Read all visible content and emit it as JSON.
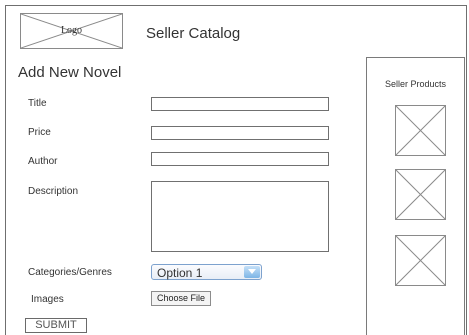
{
  "header": {
    "logo_text": "Logo",
    "app_title": "Seller Catalog"
  },
  "form": {
    "title": "Add New Novel",
    "title_label": "Title",
    "title_value": "",
    "price_label": "Price",
    "price_value": "",
    "author_label": "Author",
    "author_value": "",
    "description_label": "Description",
    "description_value": "",
    "categories_label": "Categories/Genres",
    "categories_selected": "Option 1",
    "images_label": "Images",
    "choose_file_label": "Choose File",
    "submit_label": "SUBMIT"
  },
  "seller_products": {
    "title": "Seller Products",
    "items": [
      {
        "icon": "image-placeholder-icon"
      },
      {
        "icon": "image-placeholder-icon"
      },
      {
        "icon": "image-placeholder-icon"
      }
    ]
  },
  "colors": {
    "border": "#707070",
    "select_accent": "#7db5e6"
  }
}
